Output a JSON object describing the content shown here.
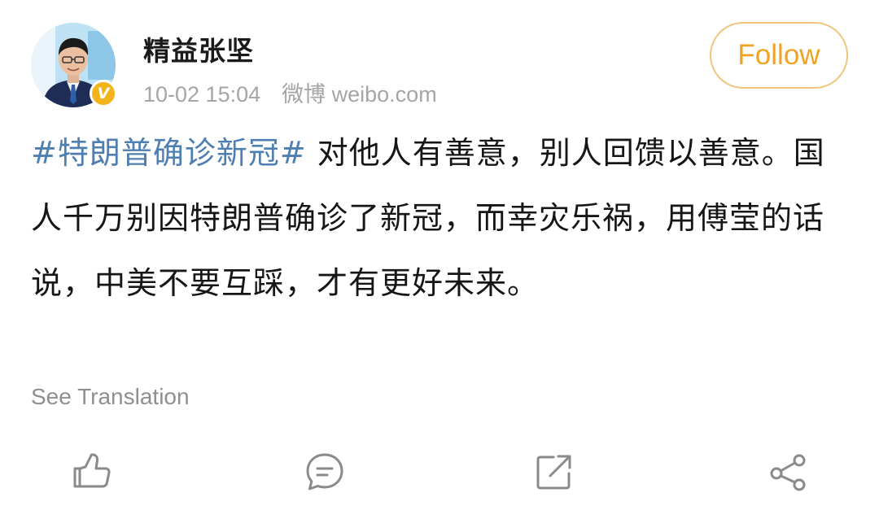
{
  "post": {
    "username": "精益张坚",
    "timestamp": "10-02 15:04",
    "source": "微博 weibo.com",
    "follow_label": "Follow",
    "hashtag": "#特朗普确诊新冠#",
    "body_text": " 对他人有善意，别人回馈以善意。国人千万别因特朗普确诊了新冠，而幸灾乐祸，用傅莹的话说，中美不要互踩，才有更好未来。",
    "see_translation": "See Translation",
    "verified_badge": "V"
  },
  "actions": [
    {
      "icon": "thumbs-up-icon"
    },
    {
      "icon": "comment-icon"
    },
    {
      "icon": "repost-icon"
    },
    {
      "icon": "share-icon"
    }
  ],
  "colors": {
    "hashtag": "#4f7fb1",
    "follow_text": "#f0a223",
    "follow_border": "#f0c57c",
    "verified": "#f2b418",
    "meta_text": "#a5a5a5",
    "icon": "#8a8a8a"
  }
}
